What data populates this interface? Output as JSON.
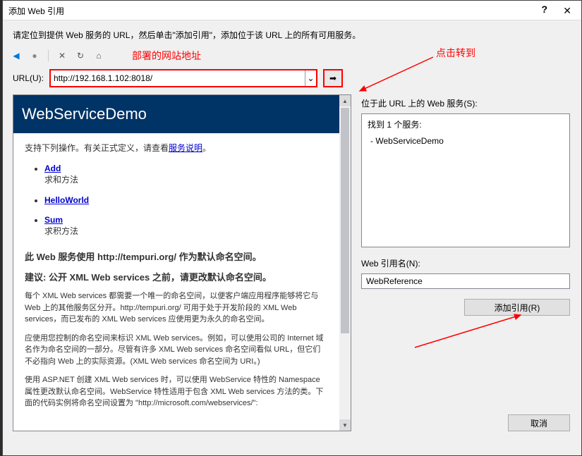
{
  "window": {
    "title": "添加 Web 引用",
    "help_symbol": "?",
    "close_symbol": "✕"
  },
  "instruction": "请定位到提供 Web 服务的 URL，然后单击\"添加引用\"，添加位于该 URL 上的所有可用服务。",
  "annotations": {
    "go_label": "点击转到",
    "url_label": "部署的网站地址"
  },
  "nav": {
    "back": "◀",
    "stop": "●",
    "cancel": "✕",
    "refresh": "↻",
    "home": "⌂"
  },
  "url": {
    "label": "URL(U):",
    "value": "http://192.168.1.102:8018/",
    "dropdown": "⌄",
    "go": "➡"
  },
  "document": {
    "header": "WebServiceDemo",
    "support_text_pre": "支持下列操作。有关正式定义，请查看",
    "support_link": "服务说明",
    "support_text_post": "。",
    "operations": [
      {
        "name": "Add",
        "desc": "求和方法"
      },
      {
        "name": "HelloWorld",
        "desc": ""
      },
      {
        "name": "Sum",
        "desc": "求积方法"
      }
    ],
    "ns_line1": "此 Web 服务使用 http://tempuri.org/ 作为默认命名空间。",
    "ns_line2": "建议: 公开 XML Web services 之前，请更改默认命名空间。",
    "para1": "每个 XML Web services 都需要一个唯一的命名空间，以便客户端应用程序能够将它与 Web 上的其他服务区分开。http://tempuri.org/ 可用于处于开发阶段的 XML Web services，而已发布的 XML Web services 应使用更为永久的命名空间。",
    "para2": "应使用您控制的命名空间来标识 XML Web services。例如，可以使用公司的 Internet 域名作为命名空间的一部分。尽管有许多 XML Web services 命名空间看似 URL，但它们不必指向 Web 上的实际资源。(XML Web services 命名空间为 URI。)",
    "para3": "使用 ASP.NET 创建 XML Web services 时，可以使用 WebService 特性的 Namespace 属性更改默认命名空间。WebService 特性适用于包含 XML Web services 方法的类。下面的代码实例将命名空间设置为 \"http://microsoft.com/webservices/\":"
  },
  "right": {
    "services_label": "位于此 URL 上的 Web 服务(S):",
    "found_text": "找到 1 个服务:",
    "service_item": "- WebServiceDemo",
    "refname_label": "Web 引用名(N):",
    "refname_value": "WebReference",
    "add_button": "添加引用(R)",
    "cancel_button": "取消"
  }
}
